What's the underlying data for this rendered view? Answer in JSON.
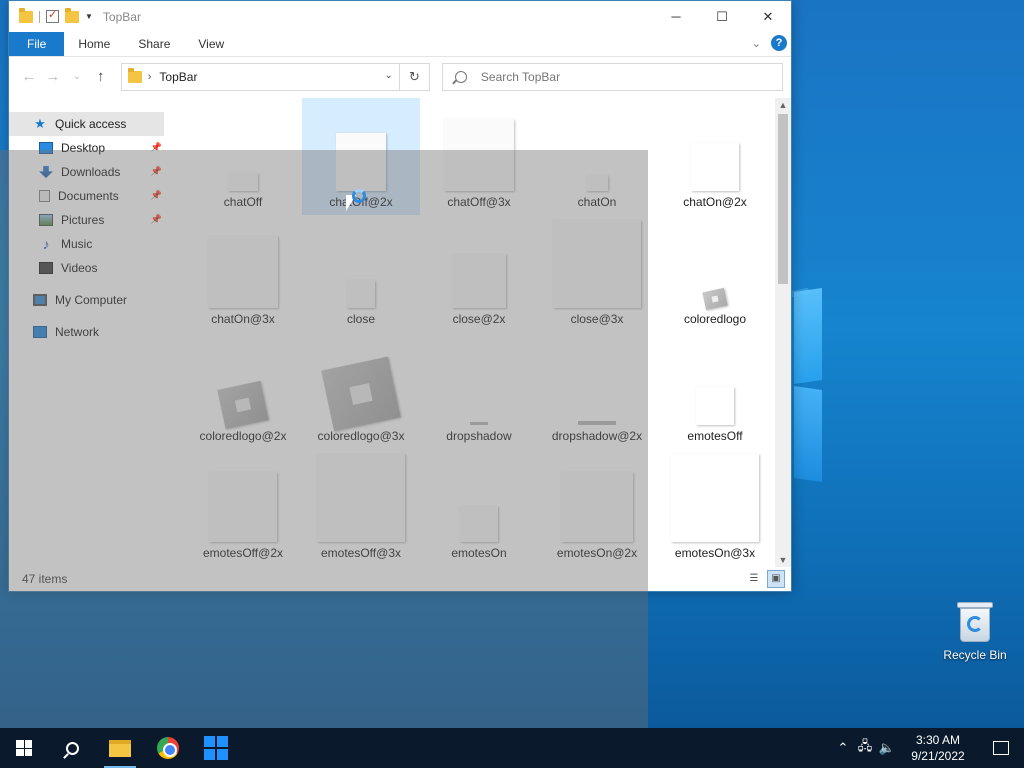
{
  "window": {
    "title": "TopBar",
    "controls": {
      "minimize": "─",
      "maximize": "☐",
      "close": "✕"
    }
  },
  "ribbon": {
    "tabs": [
      "File",
      "Home",
      "Share",
      "View"
    ],
    "collapse": "⌄",
    "help": "?"
  },
  "navigation": {
    "back": "←",
    "forward": "→",
    "up": "↑",
    "path": "TopBar",
    "refresh": "↻",
    "search_placeholder": "Search TopBar"
  },
  "sidebar": {
    "quick_access": "Quick access",
    "items": [
      {
        "label": "Desktop",
        "icon": "desktop-icon",
        "pinned": true
      },
      {
        "label": "Downloads",
        "icon": "downloads-icon",
        "pinned": true
      },
      {
        "label": "Documents",
        "icon": "documents-icon",
        "pinned": true
      },
      {
        "label": "Pictures",
        "icon": "pictures-icon",
        "pinned": true
      },
      {
        "label": "Music",
        "icon": "music-icon",
        "pinned": false
      },
      {
        "label": "Videos",
        "icon": "videos-icon",
        "pinned": false
      }
    ],
    "my_computer": "My Computer",
    "network": "Network"
  },
  "files": [
    {
      "name": "chatOff",
      "style": "plain"
    },
    {
      "name": "chatOff@2x",
      "style": "plain"
    },
    {
      "name": "chatOff@3x",
      "style": "plain"
    },
    {
      "name": "chatOn",
      "style": "plain"
    },
    {
      "name": "chatOn@2x",
      "style": "white"
    },
    {
      "name": "chatOn@3x",
      "style": "plain"
    },
    {
      "name": "close",
      "style": "plain"
    },
    {
      "name": "close@2x",
      "style": "plain"
    },
    {
      "name": "close@3x",
      "style": "plain"
    },
    {
      "name": "coloredlogo",
      "style": "logo"
    },
    {
      "name": "coloredlogo@2x",
      "style": "logo"
    },
    {
      "name": "coloredlogo@3x",
      "style": "logo"
    },
    {
      "name": "dropshadow",
      "style": "bar"
    },
    {
      "name": "dropshadow@2x",
      "style": "bar"
    },
    {
      "name": "emotesOff",
      "style": "white"
    },
    {
      "name": "emotesOff@2x",
      "style": "plain"
    },
    {
      "name": "emotesOff@3x",
      "style": "plain"
    },
    {
      "name": "emotesOn",
      "style": "plain"
    },
    {
      "name": "emotesOn@2x",
      "style": "plain"
    },
    {
      "name": "emotesOn@3x",
      "style": "white"
    }
  ],
  "status": {
    "item_count": "47 items"
  },
  "desktop": {
    "recycle_bin": "Recycle Bin"
  },
  "taskbar": {
    "time": "3:30 AM",
    "date": "9/21/2022",
    "tray_icons": [
      "chevron-up-icon",
      "network-icon",
      "volume-icon"
    ]
  },
  "colors": {
    "accent": "#1979ca",
    "desktop": "#1684cf",
    "taskbar": "#0a1a2c"
  }
}
